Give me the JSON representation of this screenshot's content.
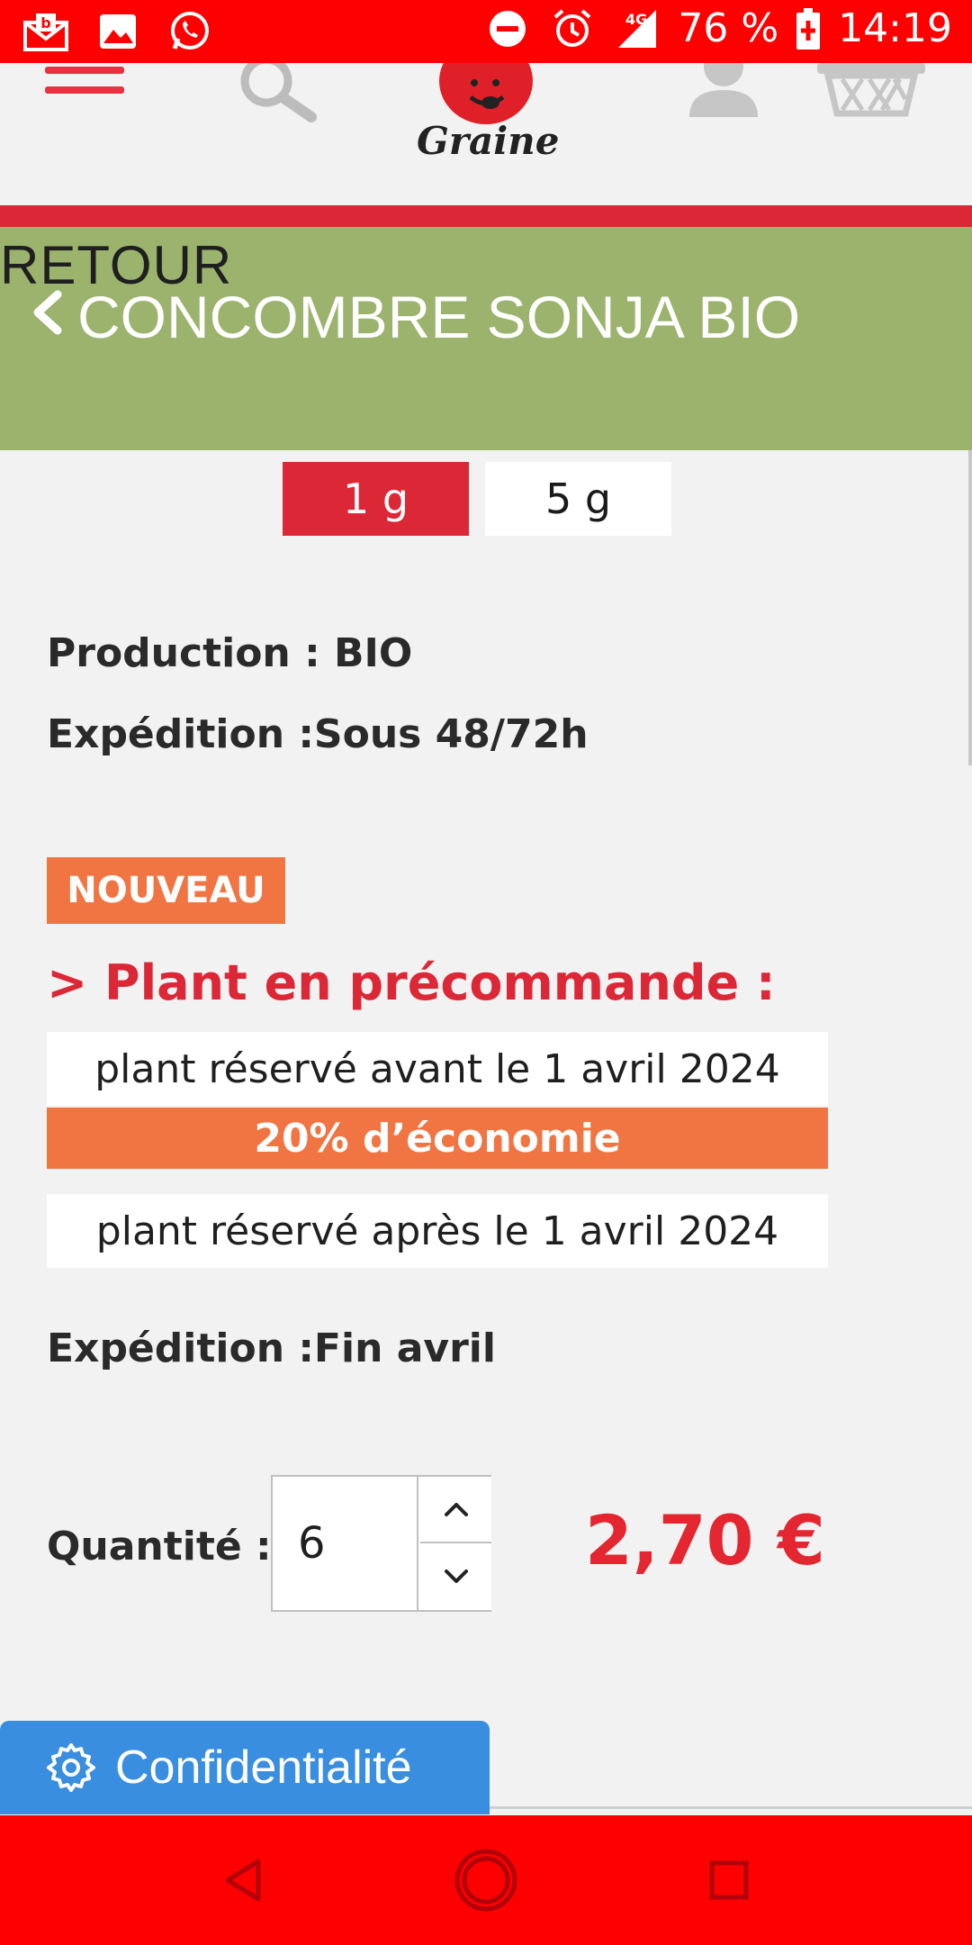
{
  "status_bar": {
    "battery": "76 %",
    "time": "14:19",
    "network": "4G",
    "icons": [
      "mail-icon",
      "gallery-icon",
      "whatsapp-icon",
      "dnd-icon",
      "alarm-icon",
      "signal-icon",
      "battery-icon"
    ]
  },
  "header": {
    "logo_text": "Graine",
    "icons": [
      "menu-icon",
      "search-icon",
      "account-icon",
      "basket-icon"
    ]
  },
  "banner": {
    "back_label": "RETOUR",
    "product_title": "CONCOMBRE SONJA BIO"
  },
  "weights": [
    {
      "label": "1 g",
      "selected": true
    },
    {
      "label": "5 g",
      "selected": false
    }
  ],
  "info": {
    "production": "Production : BIO",
    "shipping": "Expédition :Sous 48/72h"
  },
  "preorder": {
    "badge": "NOUVEAU",
    "title": "> Plant en précommande :",
    "option_before": "plant réservé avant le 1 avril 2024",
    "discount": "20% d’économie",
    "option_after": "plant réservé après le 1 avril 2024",
    "shipping": "Expédition :Fin avril"
  },
  "quantity": {
    "label": "Quantité :",
    "value": "6"
  },
  "price": "2,70 €",
  "privacy_button": "Confidentialité",
  "colors": {
    "brand_red": "#dc2737",
    "banner_green": "#9bb36c",
    "accent_orange": "#f07542",
    "price_red": "#e3262f",
    "privacy_blue": "#3a8ee0",
    "system_bar_red": "#ff0000"
  }
}
